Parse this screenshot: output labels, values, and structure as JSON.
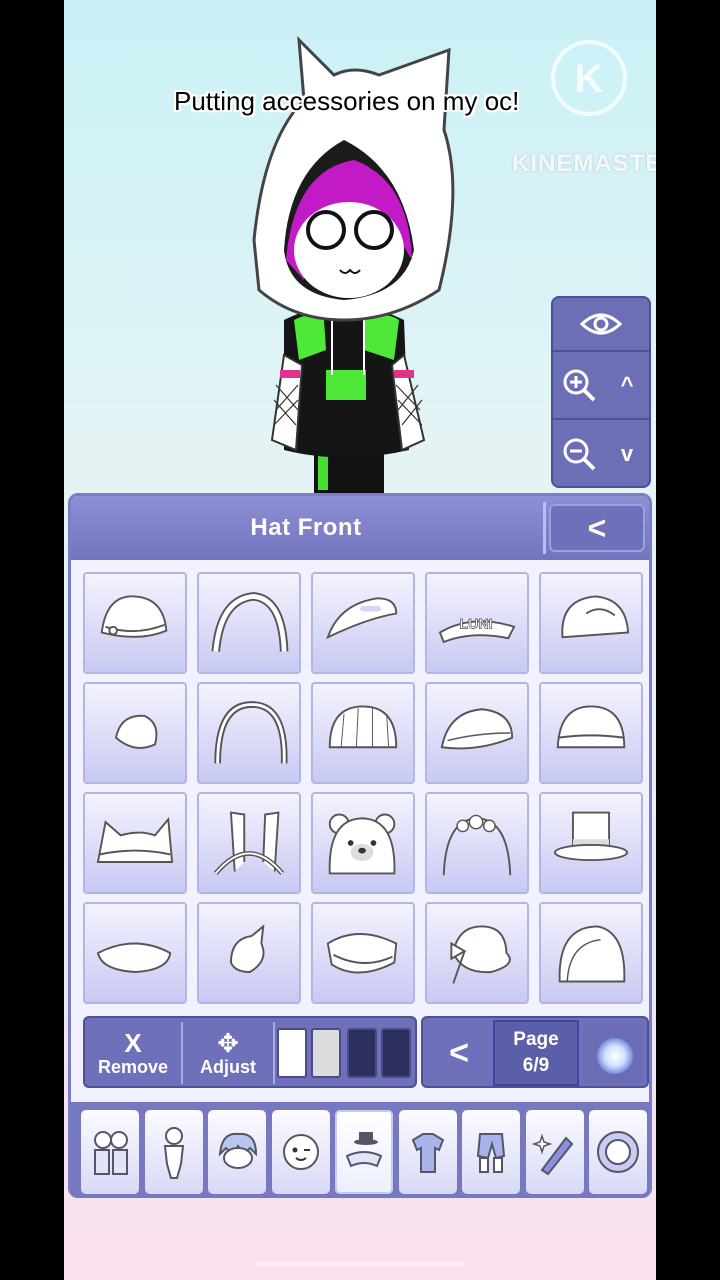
{
  "video": {
    "caption": "Putting accessories on my oc!",
    "watermark_text": "KINEMASTER",
    "watermark_logo_letter": "K"
  },
  "camera_controls": {
    "visibility_icon": "eye-icon",
    "zoom_in_icon": "zoom-in-icon",
    "zoom_out_icon": "zoom-out-icon",
    "up_arrow": "^",
    "down_arrow": "v"
  },
  "panel": {
    "title": "Hat Front",
    "back_label": "<",
    "items": [
      "hat-bow-bowler",
      "hat-headband-ribbed",
      "hat-visor",
      "hat-visor-luni",
      "hat-baseball-cap",
      "hat-small-beret",
      "hat-headband-plain",
      "hat-beanie-ribbed",
      "hat-cap-folded",
      "hat-beanie-knit",
      "hat-cat-ear-beanie",
      "hat-bunny-ears",
      "hat-bear-hood",
      "hat-flower-crown-veil",
      "hat-top-hat",
      "hat-flat-beret",
      "hat-small-tilted",
      "hat-sailor-cap",
      "hat-bow-sunhat",
      "hat-bonnet"
    ],
    "tile_text_luni": "LUNI"
  },
  "toolbar": {
    "remove_icon": "X",
    "remove_label": "Remove",
    "adjust_icon": "✥",
    "adjust_label": "Adjust",
    "swatches": [
      "#ffffff",
      "#dcdcdc",
      "#2d2f5c",
      "#2d2f5c"
    ],
    "prev_label": "<",
    "page_label": "Page",
    "page_value": "6/9"
  },
  "tabs": [
    {
      "name": "tab-characters"
    },
    {
      "name": "tab-body"
    },
    {
      "name": "tab-hair"
    },
    {
      "name": "tab-face"
    },
    {
      "name": "tab-accessories",
      "active": true
    },
    {
      "name": "tab-top"
    },
    {
      "name": "tab-bottom"
    },
    {
      "name": "tab-weapons"
    },
    {
      "name": "tab-profile"
    }
  ],
  "colors": {
    "panel_accent": "#7174bd",
    "hair_accent": "#c21ac6",
    "shirt_accent": "#4ee838"
  }
}
